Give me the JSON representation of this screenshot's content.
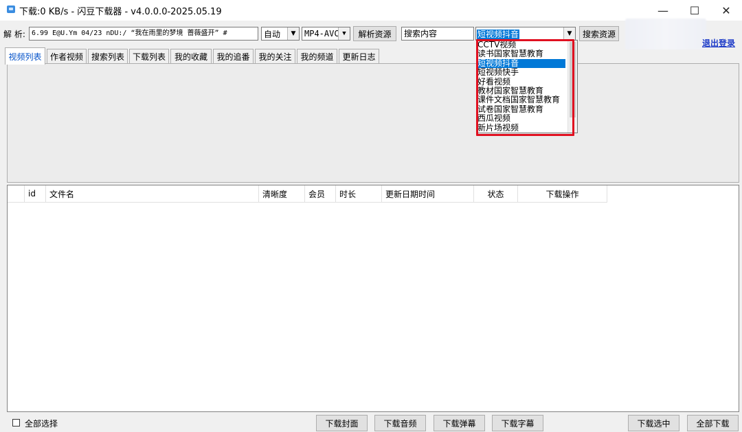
{
  "window": {
    "title": "下载:0 KB/s - 闪豆下载器 - v4.0.0.0-2025.05.19",
    "controls": {
      "minimize": "—",
      "maximize": "☐",
      "close": "✕"
    }
  },
  "toolbar": {
    "parse_label": "解 析:",
    "parse_value": "6.99 E@U.Ym 04/23 nDU:/ “我在雨里的梦境 蔷薇盛开” #",
    "quality_value": "自动",
    "format_value": "MP4-AVC",
    "parse_button": "解析资源",
    "search_value": "搜索内容",
    "platform_value": "短视频抖音",
    "search_button": "搜索资源",
    "logout_link": "退出登录"
  },
  "tabs": [
    "视频列表",
    "作者视频",
    "搜索列表",
    "下载列表",
    "我的收藏",
    "我的追番",
    "我的关注",
    "我的频道",
    "更新日志"
  ],
  "active_tab": 0,
  "table": {
    "columns": [
      "",
      "id",
      "文件名",
      "清晰度",
      "会员",
      "时长",
      "更新日期时间",
      "状态",
      "下载操作"
    ]
  },
  "bottom": {
    "select_all": "全部选择",
    "buttons": [
      "下载封面",
      "下载音频",
      "下载弹幕",
      "下载字幕"
    ],
    "download_selected": "下载选中",
    "download_all": "全部下载"
  },
  "dropdown": {
    "items": [
      "CCTV视频",
      "读书国家智慧教育",
      "短视频抖音",
      "短视频快手",
      "好看视频",
      "教材国家智慧教育",
      "课件文档国家智慧教育",
      "试卷国家智慧教育",
      "西瓜视频",
      "新片场视频"
    ],
    "selected_index": 2
  },
  "colors": {
    "accent": "#0078d7",
    "highlight_border": "#e01020",
    "link": "#1e3cc8"
  }
}
